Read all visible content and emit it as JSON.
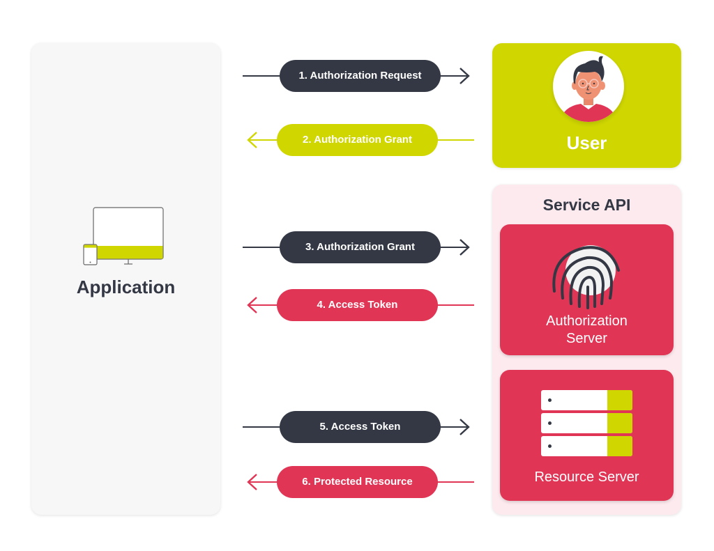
{
  "colors": {
    "dark": "#333844",
    "lime": "#cfd600",
    "red": "#e03555",
    "pink_bg": "#fdeaee",
    "app_bg": "#f7f7f7"
  },
  "application": {
    "title": "Application",
    "icon": "devices-icon"
  },
  "user": {
    "title": "User",
    "icon": "user-avatar-icon"
  },
  "service_api": {
    "title": "Service API",
    "authorization_server": {
      "label_line1": "Authorization",
      "label_line2": "Server",
      "icon": "fingerprint-icon"
    },
    "resource_server": {
      "label": "Resource Server",
      "icon": "server-rack-icon"
    }
  },
  "flows": [
    {
      "step": 1,
      "label": "1. Authorization Request",
      "direction": "right",
      "color": "#333844"
    },
    {
      "step": 2,
      "label": "2. Authorization Grant",
      "direction": "left",
      "color": "#cfd600"
    },
    {
      "step": 3,
      "label": "3. Authorization Grant",
      "direction": "right",
      "color": "#333844"
    },
    {
      "step": 4,
      "label": "4. Access Token",
      "direction": "left",
      "color": "#e03555"
    },
    {
      "step": 5,
      "label": "5. Access Token",
      "direction": "right",
      "color": "#333844"
    },
    {
      "step": 6,
      "label": "6. Protected Resource",
      "direction": "left",
      "color": "#e03555"
    }
  ]
}
